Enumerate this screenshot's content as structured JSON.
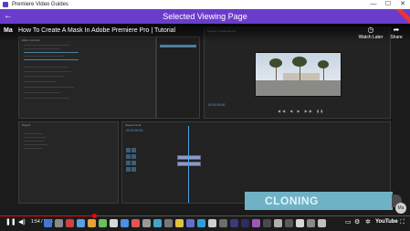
{
  "window": {
    "title": "Premiere Video Guides",
    "minimize": "—",
    "maximize": "☐",
    "close": "✕"
  },
  "appbar": {
    "back": "←",
    "heading": "Selected Viewing Page",
    "accent": "#6a3ccc"
  },
  "youtube": {
    "logo": "Ma",
    "video_title": "How To Create A Mask In Adobe Premiere Pro | Tutorial",
    "watch_later_icon": "clock-icon",
    "watch_later": "Watch Later",
    "share_icon": "share-icon",
    "share": "Share",
    "time": "1:54 / 8:16",
    "brand": "YouTube",
    "avatar": "Ma",
    "progress": 0.23
  },
  "video_overlay": {
    "caption": "CLONING"
  },
  "premiere": {
    "effect_controls_tab": "Effect Controls",
    "program_tab": "Program: Sequence 01",
    "project_tab": "Project",
    "timeline_tab": "Sequence 01",
    "program_timecode": "00:00:00:00",
    "timeline_timecode": "00:00:00:00"
  }
}
